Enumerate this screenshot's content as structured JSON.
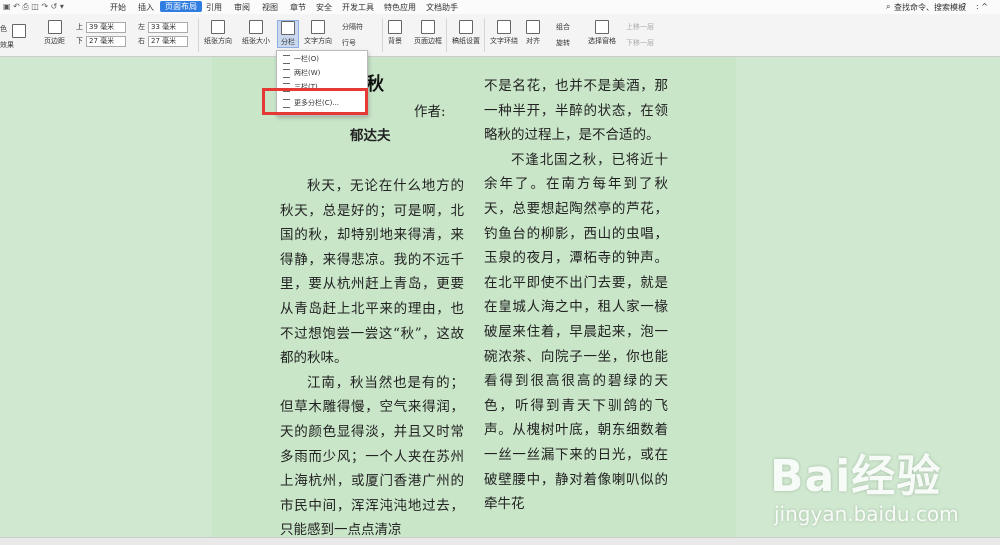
{
  "menubar": {
    "tabs": [
      "开始",
      "插入",
      "页面布局",
      "引用",
      "审阅",
      "视图",
      "章节",
      "安全",
      "开发工具",
      "特色应用",
      "文档助手"
    ],
    "active_tab": "页面布局",
    "search_label": "查找命令、搜索模板",
    "help": "?"
  },
  "toolbar": {
    "color_label": "色",
    "effect_label": "效果",
    "margin_label": "页边距",
    "margin_top_label": "上",
    "margin_top_value": "39 毫米",
    "margin_bottom_label": "下",
    "margin_bottom_value": "27 毫米",
    "margin_left_label": "左",
    "margin_left_value": "33 毫米",
    "margin_right_label": "右",
    "margin_right_value": "27 毫米",
    "orientation_label": "纸张方向",
    "size_label": "纸张大小",
    "columns_label": "分栏",
    "text_direction_label": "文字方向",
    "separator_label": "分隔符",
    "line_number_label": "行号",
    "background_label": "背景",
    "page_border_label": "页面边框",
    "paper_setup_label": "稿纸设置",
    "text_wrap_label": "文字环绕",
    "align_label": "对齐",
    "group_label": "组合",
    "rotate_label": "旋转",
    "selection_pane_label": "选择窗格",
    "bring_forward_label": "上移一层",
    "send_backward_label": "下移一层"
  },
  "dropdown": {
    "items": [
      "一栏(O)",
      "两栏(W)",
      "三栏(T)",
      "更多分栏(C)..."
    ]
  },
  "document": {
    "title": "都的秋",
    "author_label": "作者:",
    "author_name": "郁达夫",
    "col1_p1": "秋天，无论在什么地方的秋天，总是好的；可是啊，北国的秋，却特别地来得清，来得静，来得悲凉。我的不远千里，要从杭州赶上青岛，更要从青岛赶上北平来的理由，也不过想饱尝一尝这“秋”，这故都的秋味。",
    "col1_p2": "江南，秋当然也是有的；但草木雕得慢，空气来得润，天的颜色显得淡，并且又时常多雨而少风；一个人夹在苏州上海杭州，或厦门香港广州的市民中间，浑浑沌沌地过去，只能感到一点点清凉",
    "col2_p1": "不是名花，也并不是美酒，那一种半开，半醉的状态，在领略秋的过程上，是不合适的。",
    "col2_p2": "不逢北国之秋，已将近十余年了。在南方每年到了秋天，总要想起陶然亭的芦花，钓鱼台的柳影，西山的虫唱，玉泉的夜月，潭柘寺的钟声。在北平即使不出门去要，就是在皇城人海之中，租人家一椽破屋来住着，早晨起来，泡一碗浓茶、向院子一坐，你也能看得到很高很高的碧绿的天色，听得到青天下驯鸽的飞声。从槐树叶底，朝东细数着一丝一丝漏下来的日光，或在破壁腰中，静对着像喇叭似的牵牛花"
  },
  "watermark": {
    "brand": "Bai经验",
    "url": "jingyan.baidu.com"
  },
  "colors": {
    "active_tab": "#2f7de1",
    "page_bg": "#c9e6c9",
    "highlight_box": "#e53935"
  }
}
